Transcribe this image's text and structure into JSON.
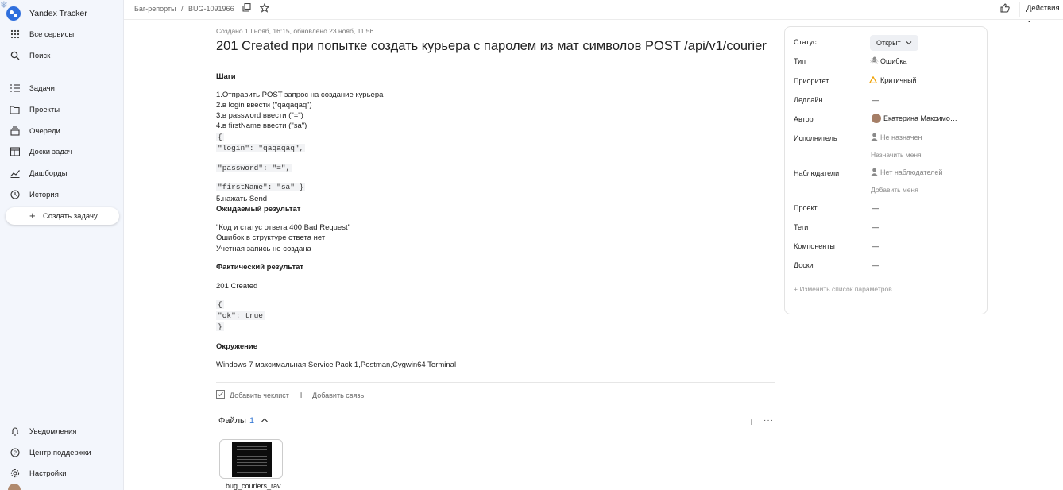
{
  "app": {
    "title": "Yandex Tracker"
  },
  "sidebar": {
    "top_items": [
      {
        "label": "Все сервисы",
        "icon": "grid-icon"
      },
      {
        "label": "Поиск",
        "icon": "search-icon"
      }
    ],
    "items": [
      {
        "label": "Задачи",
        "icon": "tasks-icon"
      },
      {
        "label": "Проекты",
        "icon": "projects-icon"
      },
      {
        "label": "Очереди",
        "icon": "queues-icon"
      },
      {
        "label": "Доски задач",
        "icon": "boards-icon"
      },
      {
        "label": "Дашборды",
        "icon": "dashboards-icon"
      },
      {
        "label": "История",
        "icon": "history-icon"
      }
    ],
    "create_label": "Создать задачу",
    "bottom_items": [
      {
        "label": "Уведомления",
        "icon": "bell-icon"
      },
      {
        "label": "Центр поддержки",
        "icon": "help-icon"
      },
      {
        "label": "Настройки",
        "icon": "gear-icon"
      }
    ]
  },
  "header": {
    "breadcrumb_queue": "Баг-репорты",
    "breadcrumb_sep": "/",
    "breadcrumb_issue": "BUG-1091966",
    "actions_label": "Действия"
  },
  "issue": {
    "meta": "Создано 10 нояб, 16:15, обновлено 23 нояб, 11:56",
    "title": "201 Created при попытке создать курьера с паролем из мат символов POST /api/v1/courier",
    "steps_heading": "Шаги",
    "steps": [
      "1.Отправить POST запрос на создание курьера",
      "2.в login ввести (\"qaqaqaq\")",
      "3.в password ввести (\"=\")",
      "4.в firstName ввести (\"sa\")"
    ],
    "steps_code": [
      "{",
      "\"login\": \"qaqaqaq\",",
      "\"password\": \"=\",",
      "\"firstName\": \"sa\" }"
    ],
    "step5": "5.нажать Send",
    "expected_heading": "Ожидаемый результат",
    "expected": [
      "\"Код и статус ответа 400 Bad Request\"",
      "Ошибок в структуре ответа нет",
      "Учетная запись не создана"
    ],
    "actual_heading": "Фактический результат",
    "actual": "201 Created",
    "actual_code": [
      "{",
      "\"ok\": true",
      "}"
    ],
    "env_heading": "Окружение",
    "env": "Windows 7 максимальная Service Pack 1,Postman,Cygwin64 Terminal",
    "add_checklist": "Добавить чеклист",
    "add_link": "Добавить связь",
    "files_label": "Файлы",
    "files_count": "1",
    "file_name": "bug_couriers_rav"
  },
  "panel": {
    "status_label": "Статус",
    "status_value": "Открыт",
    "type_label": "Тип",
    "type_value": "Ошибка",
    "priority_label": "Приоритет",
    "priority_value": "Критичный",
    "deadline_label": "Дедлайн",
    "deadline_value": "—",
    "author_label": "Автор",
    "author_value": "Екатерина Максимо…",
    "assignee_label": "Исполнитель",
    "assignee_value": "Не назначен",
    "assign_me": "Назначить меня",
    "followers_label": "Наблюдатели",
    "followers_value": "Нет наблюдателей",
    "follow_me": "Добавить меня",
    "project_label": "Проект",
    "project_value": "—",
    "tags_label": "Теги",
    "tags_value": "—",
    "components_label": "Компоненты",
    "components_value": "—",
    "boards_label": "Доски",
    "boards_value": "—",
    "edit_params": "Изменить список параметров"
  }
}
